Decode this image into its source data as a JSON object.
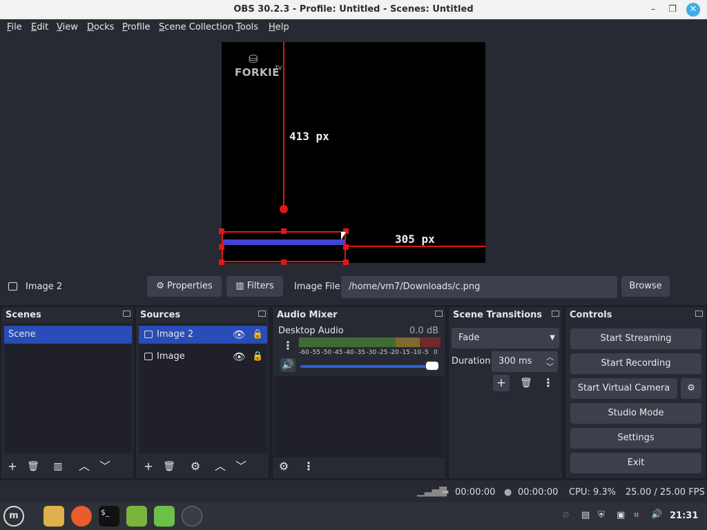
{
  "window": {
    "title": "OBS 30.2.3 - Profile: Untitled - Scenes: Untitled"
  },
  "menu": [
    "File",
    "Edit",
    "View",
    "Docks",
    "Profile",
    "Scene Collection",
    "Tools",
    "Help"
  ],
  "preview": {
    "logo_text": "FORKIE",
    "logo_tv": "TV",
    "measure_vertical": "413 px",
    "measure_horizontal": "305 px"
  },
  "source_bar": {
    "selected_source": "Image 2",
    "properties_label": "Properties",
    "filters_label": "Filters",
    "image_file_label": "Image File",
    "image_file_value": "/home/vm7/Downloads/c.png",
    "browse_label": "Browse"
  },
  "scenes": {
    "title": "Scenes",
    "items": [
      "Scene"
    ]
  },
  "sources": {
    "title": "Sources",
    "items": [
      "Image 2",
      "Image"
    ]
  },
  "audio_mixer": {
    "title": "Audio Mixer",
    "channel": "Desktop Audio",
    "level": "0.0 dB",
    "scale": [
      "-60",
      "-55",
      "-50",
      "-45",
      "-40",
      "-35",
      "-30",
      "-25",
      "-20",
      "-15",
      "-10",
      "-5",
      "0"
    ],
    "volume_fraction": 1.0
  },
  "transitions": {
    "title": "Scene Transitions",
    "selected": "Fade",
    "duration_label": "Duration",
    "duration_value": "300 ms"
  },
  "controls": {
    "title": "Controls",
    "start_streaming": "Start Streaming",
    "start_recording": "Start Recording",
    "start_virtual_camera": "Start Virtual Camera",
    "studio_mode": "Studio Mode",
    "settings": "Settings",
    "exit": "Exit"
  },
  "status": {
    "stream_time": "00:00:00",
    "record_time": "00:00:00",
    "cpu": "CPU: 9.3%",
    "fps": "25.00 / 25.00 FPS"
  },
  "taskbar": {
    "clock": "21:31"
  },
  "colors": {
    "accent": "#284cb8",
    "guide": "#e01717",
    "bar": "#4343d6"
  }
}
